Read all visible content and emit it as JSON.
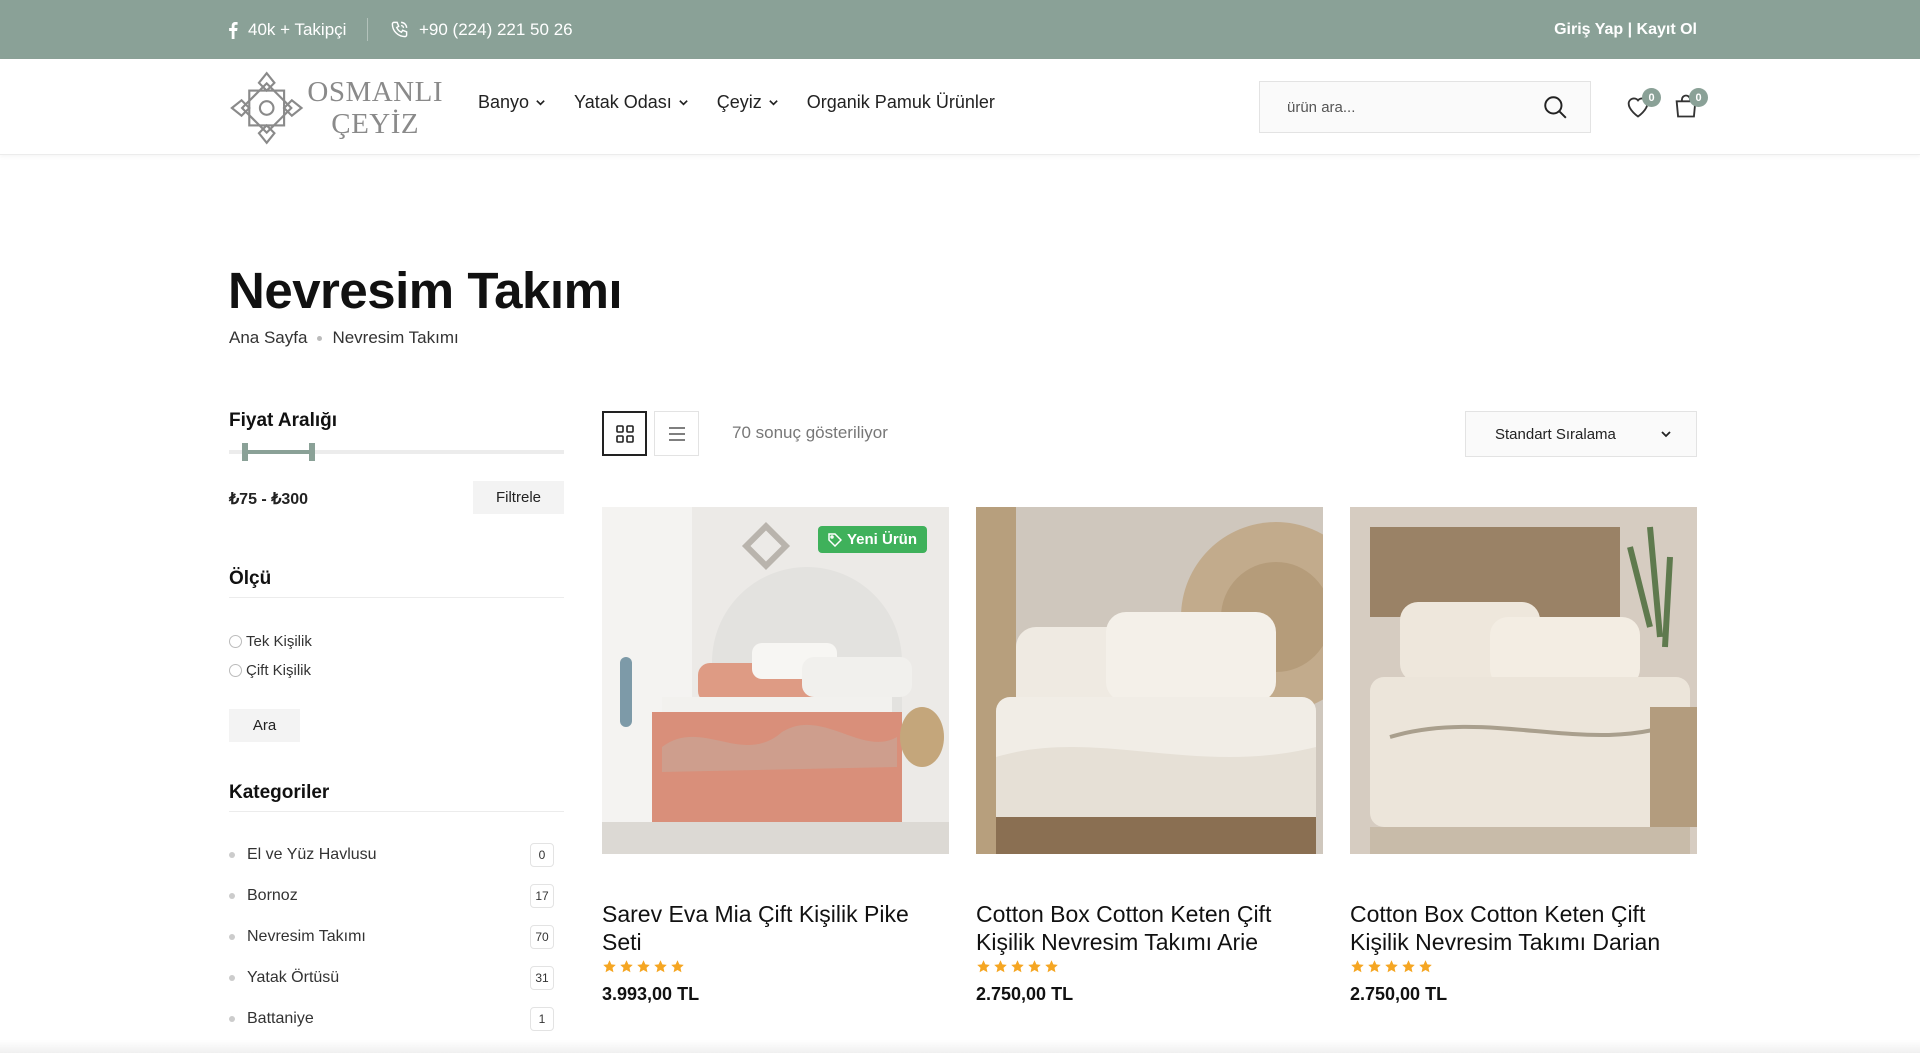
{
  "topbar": {
    "followers": "40k + Takipçi",
    "phone": "+90 (224) 221 50 26",
    "auth": "Giriş Yap | Kayıt Ol"
  },
  "logo": {
    "line1": "OSMANLI",
    "line2": "ÇEYİZ"
  },
  "nav": [
    {
      "label": "Banyo",
      "has_dropdown": true
    },
    {
      "label": "Yatak Odası",
      "has_dropdown": true
    },
    {
      "label": "Çeyiz",
      "has_dropdown": true
    },
    {
      "label": "Organik Pamuk Ürünler",
      "has_dropdown": false
    }
  ],
  "search": {
    "placeholder": "ürün ara..."
  },
  "header_icons": {
    "wishlist_count": "0",
    "cart_count": "0"
  },
  "page": {
    "title": "Nevresim Takımı",
    "breadcrumb": [
      "Ana Sayfa",
      "Nevresim Takımı"
    ]
  },
  "sidebar": {
    "price": {
      "title": "Fiyat Aralığı",
      "range_text": "₺75 - ₺300",
      "button": "Filtrele"
    },
    "size": {
      "title": "Ölçü",
      "options": [
        "Tek Kişilik",
        "Çift Kişilik"
      ],
      "button": "Ara"
    },
    "categories": {
      "title": "Kategoriler",
      "items": [
        {
          "name": "El ve Yüz Havlusu",
          "count": "0"
        },
        {
          "name": "Bornoz",
          "count": "17"
        },
        {
          "name": "Nevresim Takımı",
          "count": "70"
        },
        {
          "name": "Yatak Örtüsü",
          "count": "31"
        },
        {
          "name": "Battaniye",
          "count": "1"
        }
      ]
    }
  },
  "toolbar": {
    "result_count": "70 sonuç gösteriliyor",
    "sort": "Standart Sıralama"
  },
  "products": [
    {
      "title": "Sarev Eva Mia Çift Kişilik Pike Seti",
      "price": "3.993,00 TL",
      "rating": 5,
      "badge": "Yeni Ürün"
    },
    {
      "title": "Cotton Box Cotton Keten Çift Kişilik Nevresim Takımı Arie",
      "price": "2.750,00 TL",
      "rating": 5,
      "badge": ""
    },
    {
      "title": "Cotton Box Cotton Keten Çift Kişilik Nevresim Takımı Darian",
      "price": "2.750,00 TL",
      "rating": 5,
      "badge": ""
    }
  ],
  "colors": {
    "accent": "#8aa197",
    "badge_green": "#3fb15b",
    "star": "#f5a623"
  }
}
